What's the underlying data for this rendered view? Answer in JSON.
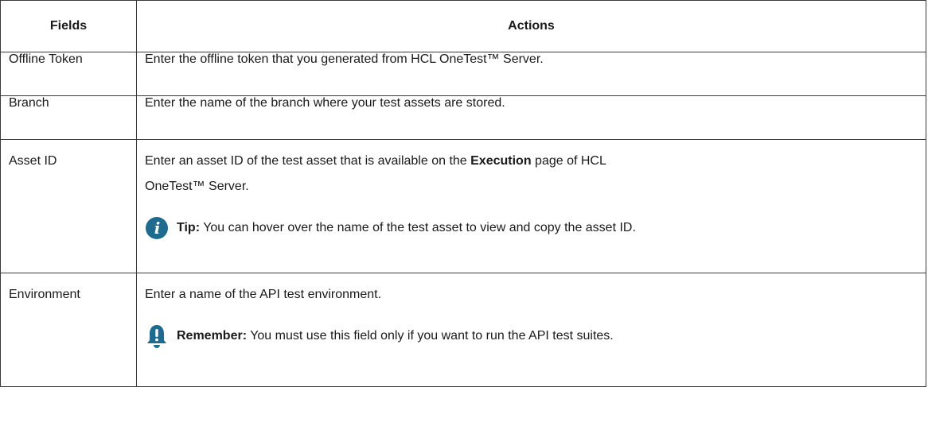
{
  "table": {
    "headers": [
      "Fields",
      "Actions"
    ],
    "rows": [
      {
        "field": "Offline Token",
        "action": "Enter the offline token that you generated from HCL OneTest™ Server."
      },
      {
        "field": "Branch",
        "action": "Enter the name of the branch where your test assets are stored."
      },
      {
        "field": "Asset ID",
        "action_prefix": "Enter an asset ID of the test asset that is available on the ",
        "action_bold": "Execution",
        "action_suffix_line1": " page of HCL",
        "action_suffix_line2": "OneTest™ Server.",
        "note": {
          "icon": "info-icon",
          "label": "Tip:",
          "text": " You can hover over the name of the test asset to view and copy the asset ID."
        }
      },
      {
        "field": "Environment",
        "action": "Enter a name of the API test environment.",
        "note": {
          "icon": "bell-icon",
          "label": "Remember:",
          "text": " You must use this field only if you want to run the API test suites."
        }
      }
    ]
  },
  "colors": {
    "icon": "#1e6b8f",
    "border": "#3a3a3a",
    "text": "#1a1a1a"
  }
}
